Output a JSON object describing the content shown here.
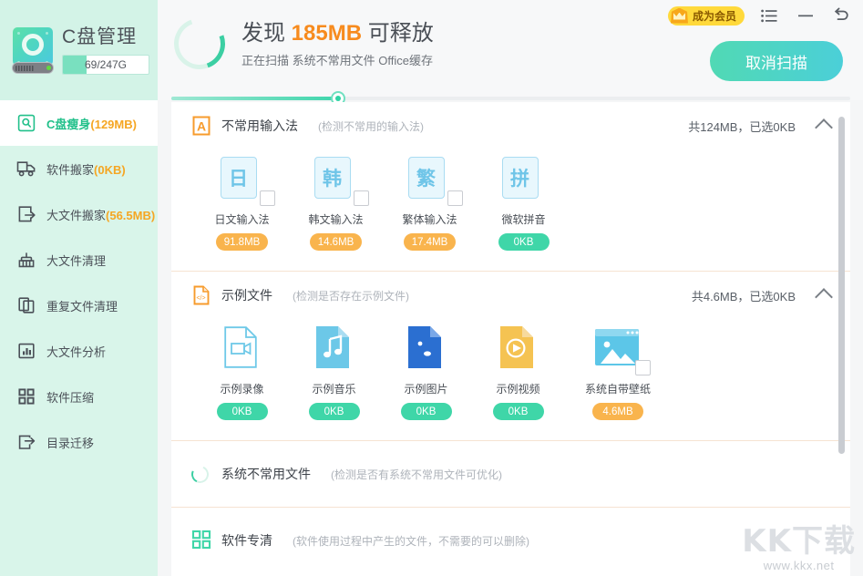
{
  "brand": {
    "title": "C盘管理",
    "disk_usage": "69/247G",
    "disk_percent": 28,
    "disk_icon": "hard-disk-icon"
  },
  "titlebar": {
    "vip_label": "成为会员",
    "vip_icon": "crown-icon",
    "menu_icon": "list-menu-icon",
    "minimize_icon": "minimize-icon",
    "restore_icon": "undo-arrow-icon"
  },
  "scan": {
    "spinner_icon": "loading-spinner-icon",
    "title_prefix": "发现 ",
    "title_amount": "185MB",
    "title_suffix": " 可释放",
    "subtitle": "正在扫描 系统不常用文件 Office缓存",
    "cancel_label": "取消扫描",
    "progress_percent": 24.5
  },
  "sidebar": {
    "items": [
      {
        "label": "C盘瘦身",
        "size": "(129MB)",
        "icon": "disk-search-icon",
        "active": true
      },
      {
        "label": "软件搬家",
        "size": "(0KB)",
        "icon": "truck-move-icon",
        "active": false
      },
      {
        "label": "大文件搬家",
        "size": "(56.5MB)",
        "icon": "file-export-icon",
        "active": false
      },
      {
        "label": "大文件清理",
        "size": "",
        "icon": "broom-icon",
        "active": false
      },
      {
        "label": "重复文件清理",
        "size": "",
        "icon": "copy-files-icon",
        "active": false
      },
      {
        "label": "大文件分析",
        "size": "",
        "icon": "bar-chart-icon",
        "active": false
      },
      {
        "label": "软件压缩",
        "size": "",
        "icon": "grid-squares-icon",
        "active": false
      },
      {
        "label": "目录迁移",
        "size": "",
        "icon": "folder-export-icon",
        "active": false
      }
    ]
  },
  "sections": [
    {
      "id": "unused-ime",
      "icon": "letter-a-icon",
      "title": "不常用输入法",
      "desc": "(检测不常用的输入法)",
      "stat": "共124MB，已选0KB",
      "collapse_icon": "chevron-up-icon",
      "kind": "ime",
      "tiles": [
        {
          "glyph": "日",
          "name": "日文输入法",
          "size": "91.8MB",
          "badge": "orange",
          "checkbox": true
        },
        {
          "glyph": "韩",
          "name": "韩文输入法",
          "size": "14.6MB",
          "badge": "orange",
          "checkbox": true
        },
        {
          "glyph": "繁",
          "name": "繁体输入法",
          "size": "17.4MB",
          "badge": "orange",
          "checkbox": true
        },
        {
          "glyph": "拼",
          "name": "微软拼音",
          "size": "0KB",
          "badge": "green",
          "checkbox": false
        }
      ]
    },
    {
      "id": "sample-files",
      "icon": "code-file-icon",
      "title": "示例文件",
      "desc": "(检测是否存在示例文件)",
      "stat": "共4.6MB，已选0KB",
      "collapse_icon": "chevron-up-icon",
      "kind": "files",
      "tiles": [
        {
          "art": "video-camera-file-icon",
          "color": "#6fc9e8",
          "outline": true,
          "name": "示例录像",
          "size": "0KB",
          "badge": "green",
          "checkbox": false
        },
        {
          "art": "music-note-file-icon",
          "color": "#6cc8e8",
          "outline": false,
          "name": "示例音乐",
          "size": "0KB",
          "badge": "green",
          "checkbox": false
        },
        {
          "art": "picture-file-icon",
          "color": "#2b6fd1",
          "outline": false,
          "name": "示例图片",
          "size": "0KB",
          "badge": "green",
          "checkbox": false
        },
        {
          "art": "play-video-file-icon",
          "color": "#f5c352",
          "outline": false,
          "name": "示例视频",
          "size": "0KB",
          "badge": "green",
          "checkbox": false
        },
        {
          "art": "wallpaper-window-icon",
          "color": "#5cc6e8",
          "outline": false,
          "name": "系统自带壁纸",
          "size": "4.6MB",
          "badge": "orange",
          "checkbox": true
        }
      ]
    },
    {
      "id": "system-unused-files",
      "icon": "loading-spinner-icon",
      "title": "系统不常用文件",
      "desc": "(检测是否有系统不常用文件可优化)",
      "stat": "",
      "kind": "scanning"
    },
    {
      "id": "software-clean",
      "icon": "grid-squares-icon",
      "title": "软件专清",
      "desc": "(软件使用过程中产生的文件，不需要的可以删除)",
      "stat": "",
      "kind": "scanning"
    }
  ],
  "watermark": {
    "logo": "KK下载",
    "url": "www.kkx.net"
  },
  "colors": {
    "accent_green": "#3fd6a8",
    "accent_orange": "#f78b1e",
    "sidebar_bg": "#d9f5ea",
    "vip_yellow": "#ffd93b"
  }
}
